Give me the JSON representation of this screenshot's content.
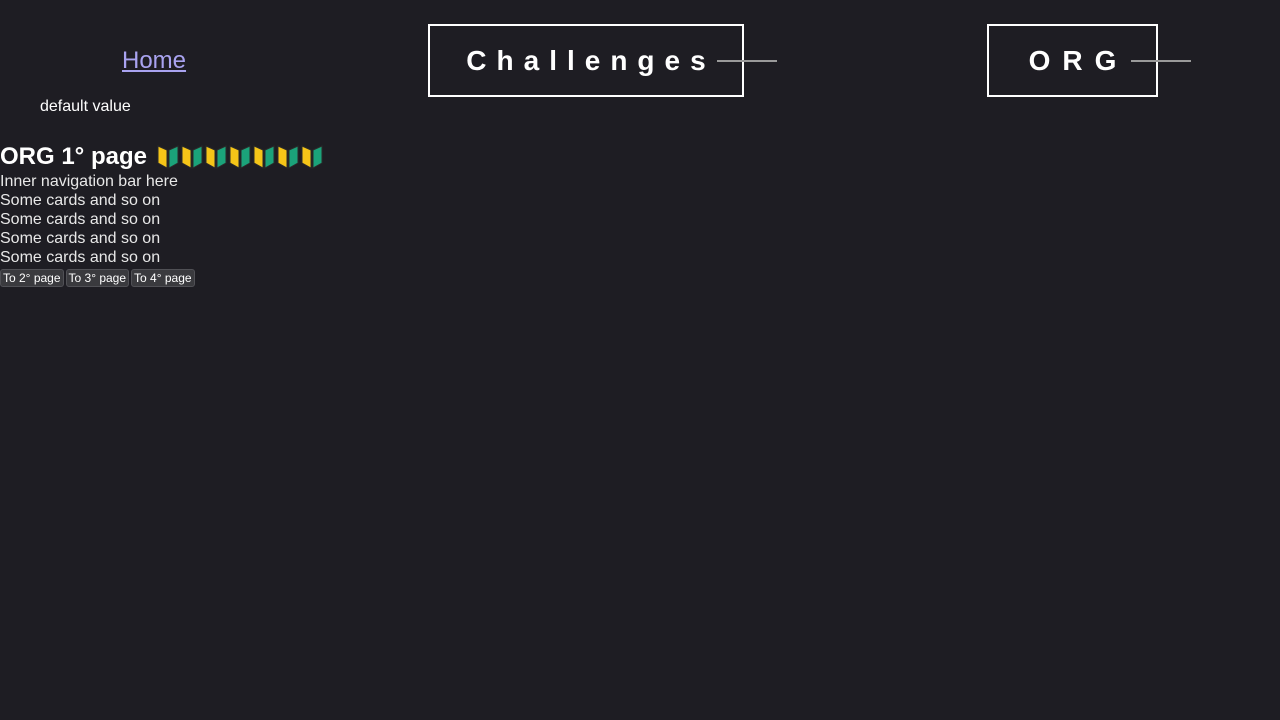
{
  "header": {
    "home_label": "Home",
    "default_value": "default value",
    "nav": [
      {
        "label": "Challenges"
      },
      {
        "label": "ORG"
      }
    ]
  },
  "main": {
    "title": "ORG 1° page",
    "badge_icon": "japanese-beginner-symbol-icon",
    "badge_count": 7,
    "lines": [
      "Inner navigation bar here",
      "Some cards and so on",
      "Some cards and so on",
      "Some cards and so on",
      "Some cards and so on"
    ],
    "buttons": [
      "To 2° page",
      "To 3° page",
      "To 4° page"
    ]
  },
  "colors": {
    "background": "#1e1d23",
    "link": "#a9a3f0",
    "badge_yellow": "#f5c518",
    "badge_green": "#1ba37a"
  }
}
